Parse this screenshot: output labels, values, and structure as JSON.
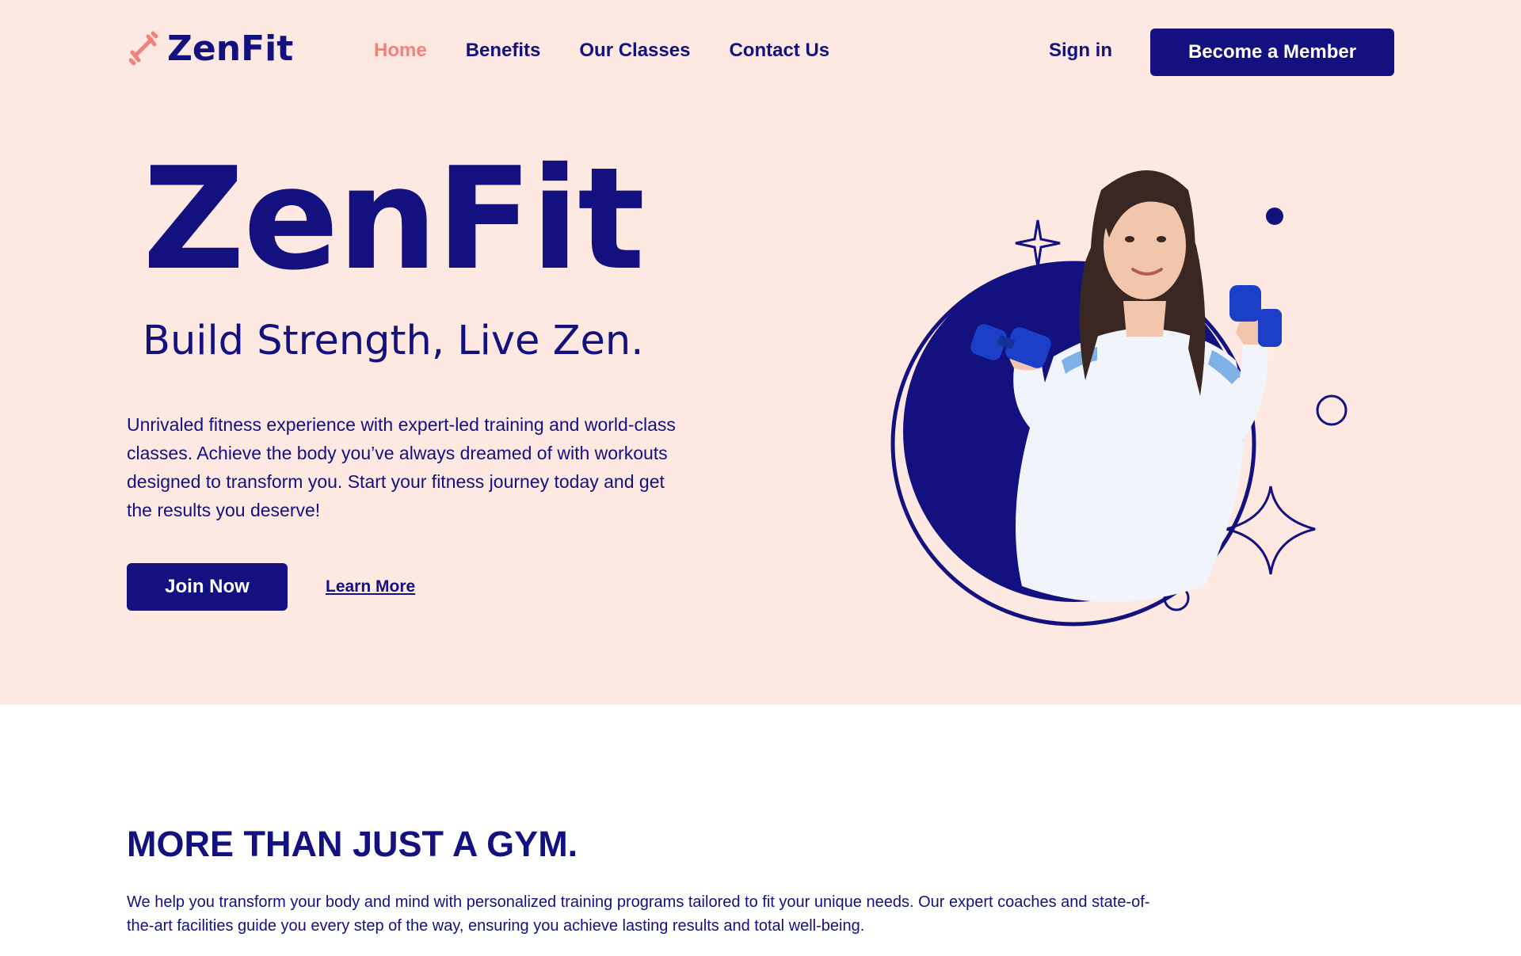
{
  "brand": {
    "name": "ZenFit",
    "logo_icon": "dumbbell-icon"
  },
  "nav": {
    "items": [
      {
        "label": "Home",
        "active": true
      },
      {
        "label": "Benefits",
        "active": false
      },
      {
        "label": "Our Classes",
        "active": false
      },
      {
        "label": "Contact Us",
        "active": false
      }
    ],
    "signin_label": "Sign in",
    "member_button_label": "Become a Member"
  },
  "hero": {
    "title": "ZenFit",
    "tagline": "Build Strength, Live Zen.",
    "description": "Unrivaled fitness experience with expert-led training and world-class classes. Achieve the body you’ve always dreamed of with workouts designed to transform you. Start your fitness journey today and get the results you deserve!",
    "join_button_label": "Join Now",
    "learn_more_label": "Learn More",
    "image": "woman-lifting-dumbbells"
  },
  "section": {
    "title": "MORE THAN JUST A GYM.",
    "description": "We help you transform your body and mind with personalized training programs tailored to fit your unique needs. Our expert coaches and state-of-the-art facilities guide you every step of the way, ensuring you achieve lasting results and total well-being."
  },
  "colors": {
    "primary": "#13117f",
    "accent": "#f77f7a",
    "hero_background": "#fee8e2",
    "button_text": "#ffffff"
  }
}
